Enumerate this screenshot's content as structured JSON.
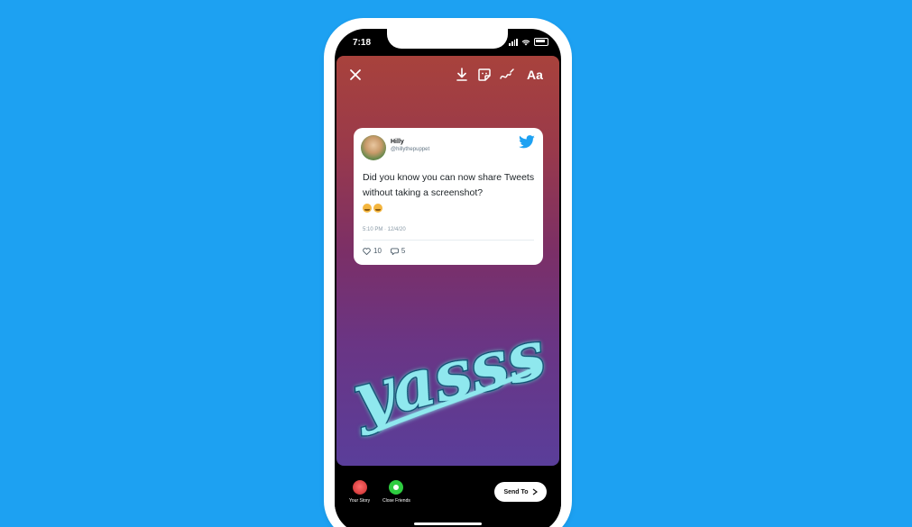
{
  "status_bar": {
    "time": "7:18"
  },
  "toolbar": {
    "close_icon": "close-icon",
    "download_icon": "download-icon",
    "sticker_icon": "sticker-icon",
    "draw_icon": "draw-icon",
    "text_label": "Aa"
  },
  "tweet": {
    "name": "Hilly",
    "handle": "@hillythepuppet",
    "text": "Did you know you can now share Tweets without taking a screenshot?",
    "timestamp": "5:10 PM · 12/4/20",
    "likes": "10",
    "replies": "5",
    "brand_color": "#1da1f2"
  },
  "sticker": {
    "text": "yasss",
    "color": "#8fe8ee"
  },
  "bottom": {
    "your_story": "Your Story",
    "close_friends": "Close Friends",
    "send_to": "Send To"
  },
  "colors": {
    "background": "#1da1f2"
  }
}
